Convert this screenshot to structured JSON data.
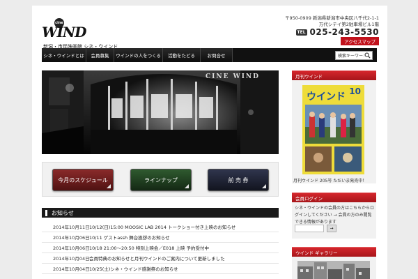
{
  "header": {
    "logo_word": "WIND",
    "logo_badge": "cine",
    "logo_sub": "新潟・市民映画館 シネ・ウインド",
    "address_line1": "〒950-0909 新潟県新潟市中央区八千代2-1-1",
    "address_line2": "万代シテイ第2駐車場ビル1階",
    "tel_label": "TEL",
    "tel": "025-243-5530",
    "access": "アクセスマップ"
  },
  "nav": {
    "items": [
      "シネ・ウインドとは",
      "会員募集",
      "ウインドの人をつくる",
      "活動をたどる",
      "お問合せ"
    ],
    "search_value": "検索キーワード"
  },
  "hero": {
    "sign": "CINE WIND"
  },
  "buttons": {
    "schedule": "今月のスケジュール",
    "lineup": "ラインナップ",
    "advance": "前 売 券"
  },
  "news": {
    "title": "お知らせ",
    "items": [
      {
        "date": "2014年10月11日",
        "title": "10/12(日)15:00 MOOSIC LAB 2014 トークショー付き上映のお知らせ"
      },
      {
        "date": "2014年10月06日",
        "title": "10/11 ゲストassh 舞台挨拶のお知らせ"
      },
      {
        "date": "2014年10月06日",
        "title": "10/18 21:00〜20:50 特別上映会／E018 上映 予約受付中"
      },
      {
        "date": "2014年10月04日",
        "title": "会員特典のお知らせと月刊ウインドのご案内について更新しました"
      },
      {
        "date": "2014年10月04日",
        "title": "10/25(土)シネ・ウインド感謝祭のお知らせ"
      }
    ]
  },
  "sidebar": {
    "magazine_head": "月刊ウインド",
    "magazine_title": "ウインド",
    "magazine_num": "10",
    "magazine_caption": "月刊ウインド 205号 ただいま発売中！",
    "member_head": "会員ログイン",
    "member_text": "シネ・ウインドの会員の方はこちらからログインしてください → 会員の方のみ閲覧できる情報があります",
    "member_btn": "→",
    "gallery_head": "ウインド ギャラリー"
  },
  "colors": {
    "accent_red": "#c1121c",
    "nav_bg": "#111111",
    "btn_red": "#7a1f1f",
    "btn_green": "#1f3d1f",
    "btn_blue": "#1d2133"
  }
}
